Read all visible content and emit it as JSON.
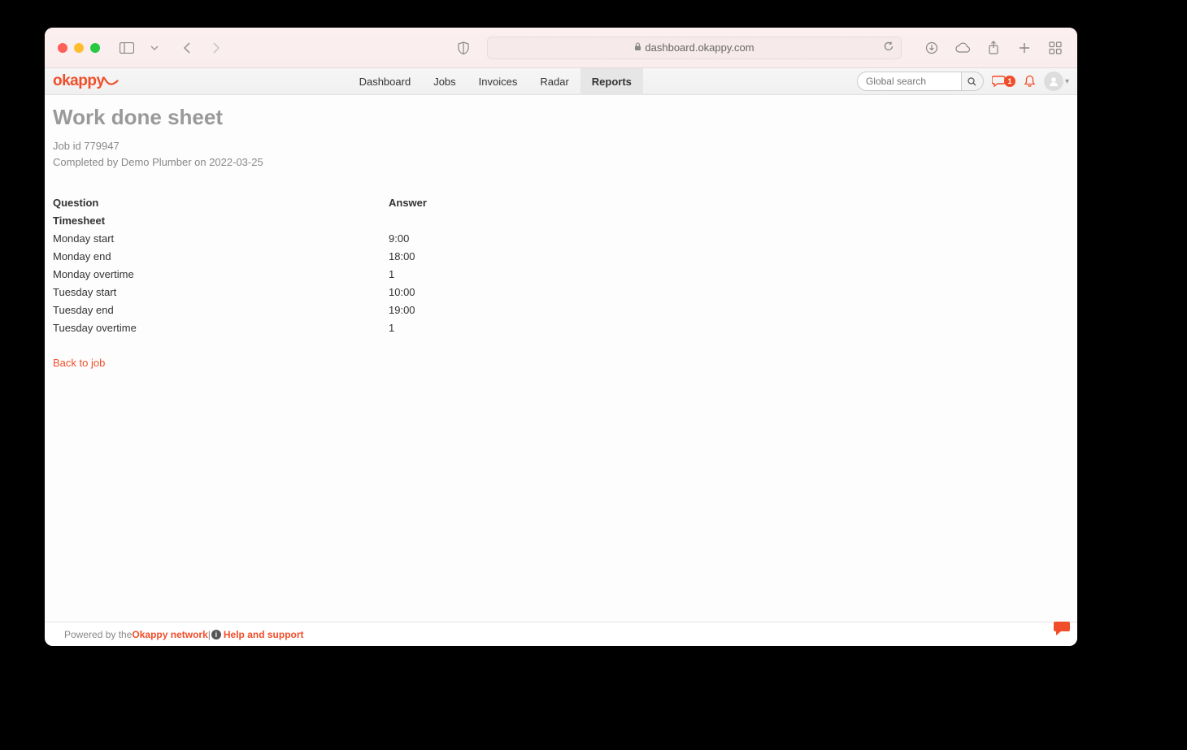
{
  "browser": {
    "url": "dashboard.okappy.com"
  },
  "logo_text": "okappy",
  "nav": {
    "items": [
      "Dashboard",
      "Jobs",
      "Invoices",
      "Radar",
      "Reports"
    ],
    "active": "Reports"
  },
  "search_placeholder": "Global search",
  "chat_badge": "1",
  "page": {
    "title": "Work done sheet",
    "job_id_line": "Job id 779947",
    "completed_line": "Completed by Demo Plumber on 2022-03-25"
  },
  "table": {
    "header_q": "Question",
    "header_a": "Answer",
    "section": "Timesheet",
    "rows": [
      {
        "q": "Monday start",
        "a": "9:00"
      },
      {
        "q": "Monday end",
        "a": "18:00"
      },
      {
        "q": "Monday overtime",
        "a": "1"
      },
      {
        "q": "Tuesday start",
        "a": "10:00"
      },
      {
        "q": "Tuesday end",
        "a": "19:00"
      },
      {
        "q": "Tuesday overtime",
        "a": "1"
      }
    ]
  },
  "back_link": "Back to job",
  "footer": {
    "powered": "Powered by the ",
    "network": "Okappy network",
    "sep": " | ",
    "help": "Help and support"
  }
}
